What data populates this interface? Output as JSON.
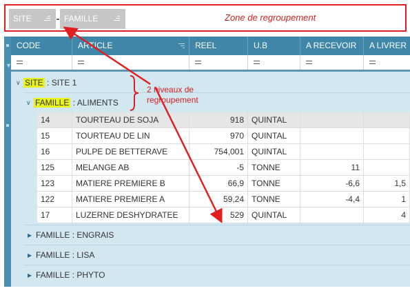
{
  "group_zone": {
    "chips": [
      {
        "label": "SITE"
      },
      {
        "label": "FAMILLE"
      }
    ],
    "label": "Zone de regroupement"
  },
  "annotation": {
    "line1": "2 niveaux de",
    "line2": "regroupement"
  },
  "columns": [
    {
      "label": "CODE"
    },
    {
      "label": "ARTICLE"
    },
    {
      "label": "REEL"
    },
    {
      "label": "U.B"
    },
    {
      "label": "A RECEVOIR"
    },
    {
      "label": "A LIVRER"
    }
  ],
  "filter_symbol": "=",
  "groups": {
    "site": {
      "field": "SITE",
      "sep": " : ",
      "value": "SITE 1"
    },
    "famille_open": {
      "field": "FAMILLE",
      "sep": " : ",
      "value": "ALIMENTS"
    },
    "collapsed": [
      {
        "label": "FAMILLE : ENGRAIS"
      },
      {
        "label": "FAMILLE : LISA"
      },
      {
        "label": "FAMILLE : PHYTO"
      }
    ]
  },
  "rows": [
    {
      "code": "14",
      "article": "TOURTEAU DE SOJA",
      "reel": "918",
      "ub": "QUINTAL",
      "recevoir": "",
      "livrer": ""
    },
    {
      "code": "15",
      "article": "TOURTEAU DE LIN",
      "reel": "970",
      "ub": "QUINTAL",
      "recevoir": "",
      "livrer": ""
    },
    {
      "code": "16",
      "article": "PULPE DE BETTERAVE",
      "reel": "754,001",
      "ub": "QUINTAL",
      "recevoir": "",
      "livrer": ""
    },
    {
      "code": "125",
      "article": "MELANGE AB",
      "reel": "-5",
      "ub": "TONNE",
      "recevoir": "11",
      "livrer": ""
    },
    {
      "code": "123",
      "article": "MATIERE PREMIERE B",
      "reel": "66,9",
      "ub": "TONNE",
      "recevoir": "-6,6",
      "livrer": "1,5"
    },
    {
      "code": "122",
      "article": "MATIERE PREMIERE A",
      "reel": "59,24",
      "ub": "TONNE",
      "recevoir": "-4,4",
      "livrer": "1"
    },
    {
      "code": "17",
      "article": "LUZERNE DESHYDRATEE",
      "reel": "529",
      "ub": "QUINTAL",
      "recevoir": "",
      "livrer": "4"
    }
  ],
  "colors": {
    "header": "#3f86a8",
    "group_bg": "#d3e7f1",
    "highlight": "#e8f21c",
    "annotation": "#d42020"
  }
}
